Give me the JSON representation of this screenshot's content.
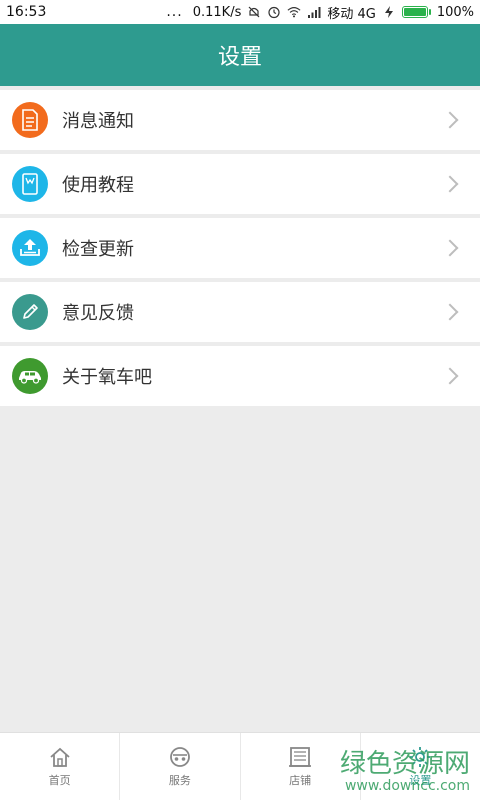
{
  "status_bar": {
    "time": "16:53",
    "dots": "...",
    "net_speed": "0.11K/s",
    "carrier": "移动 4G",
    "battery": "100%"
  },
  "header": {
    "title": "设置"
  },
  "menu": [
    {
      "label": "消息通知",
      "icon": "document-icon",
      "color": "#f26b1d"
    },
    {
      "label": "使用教程",
      "icon": "book-icon",
      "color": "#1eb6e8"
    },
    {
      "label": "检查更新",
      "icon": "upload-icon",
      "color": "#1eb6e8"
    },
    {
      "label": "意见反馈",
      "icon": "pencil-icon",
      "color": "#3a9a8e"
    },
    {
      "label": "关于氧车吧",
      "icon": "car-icon",
      "color": "#3f9a2f"
    }
  ],
  "tabs": [
    {
      "label": "首页",
      "icon": "home-icon"
    },
    {
      "label": "服务",
      "icon": "service-icon"
    },
    {
      "label": "店铺",
      "icon": "store-icon"
    },
    {
      "label": "设置",
      "icon": "settings-icon",
      "active": true
    }
  ],
  "watermark": {
    "title": "绿色资源网",
    "url": "www.downcc.com"
  }
}
